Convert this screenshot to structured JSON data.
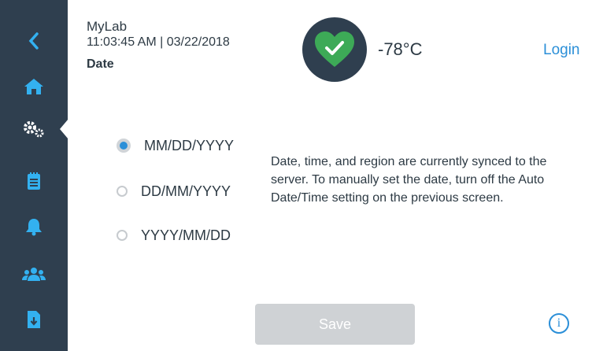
{
  "header": {
    "device_name": "MyLab",
    "datetime": "11:03:45 AM | 03/22/2018",
    "page_title": "Date",
    "temperature": "-78°C",
    "login_label": "Login"
  },
  "sidebar": {
    "items": [
      {
        "name": "back",
        "icon": "chevron-left-icon",
        "active": false
      },
      {
        "name": "home",
        "icon": "home-icon",
        "active": false
      },
      {
        "name": "settings",
        "icon": "gears-icon",
        "active": true
      },
      {
        "name": "calendar",
        "icon": "clipboard-icon",
        "active": false
      },
      {
        "name": "alarms",
        "icon": "bell-icon",
        "active": false
      },
      {
        "name": "users",
        "icon": "users-icon",
        "active": false
      },
      {
        "name": "export",
        "icon": "file-download-icon",
        "active": false
      }
    ]
  },
  "date_formats": {
    "options": [
      "MM/DD/YYYY",
      "DD/MM/YYYY",
      "YYYY/MM/DD"
    ],
    "selected": "MM/DD/YYYY"
  },
  "info_text": "Date, time, and region are currently synced to the server. To manually set the date, turn off the Auto Date/Time setting on the previous screen.",
  "save_label": "Save",
  "colors": {
    "sidebar_bg": "#2f3f4f",
    "accent": "#2b8fd8",
    "nav_icon": "#33b1f0",
    "status_ok": "#3daa57",
    "save_disabled": "#cfd2d5"
  }
}
